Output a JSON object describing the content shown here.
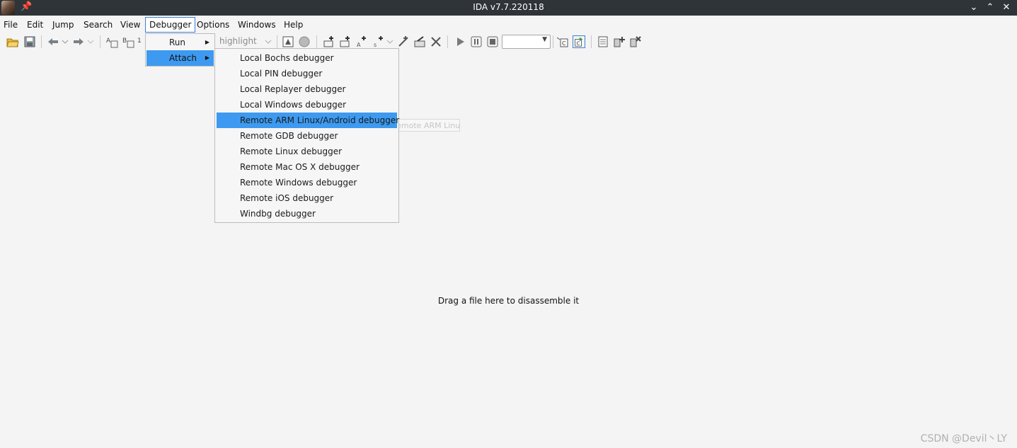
{
  "window": {
    "title": "IDA v7.7.220118"
  },
  "menubar": [
    "File",
    "Edit",
    "Jump",
    "Search",
    "View",
    "Debugger",
    "Options",
    "Windows",
    "Help"
  ],
  "toolbar": {
    "highlight_label": "highlight"
  },
  "debugger_menu": {
    "items": [
      {
        "label": "Run"
      },
      {
        "label": "Attach"
      }
    ]
  },
  "attach_submenu": {
    "items": [
      "Local Bochs debugger",
      "Local PIN debugger",
      "Local Replayer debugger",
      "Local Windows debugger",
      "Remote ARM Linux/Android debugger",
      "Remote GDB debugger",
      "Remote Linux debugger",
      "Remote Mac OS X debugger",
      "Remote Windows debugger",
      "Remote iOS debugger",
      "Windbg debugger"
    ],
    "selected": "Remote ARM Linux/Android debugger"
  },
  "tooltip_ghost": "Remote ARM Linux/Android debugger",
  "workspace": {
    "hint": "Drag a file here to disassemble it"
  },
  "watermark": "CSDN @Devil丶LY",
  "colors": {
    "titlebar": "#2f3438",
    "selection": "#3d9af0",
    "background": "#f4f4f4"
  }
}
